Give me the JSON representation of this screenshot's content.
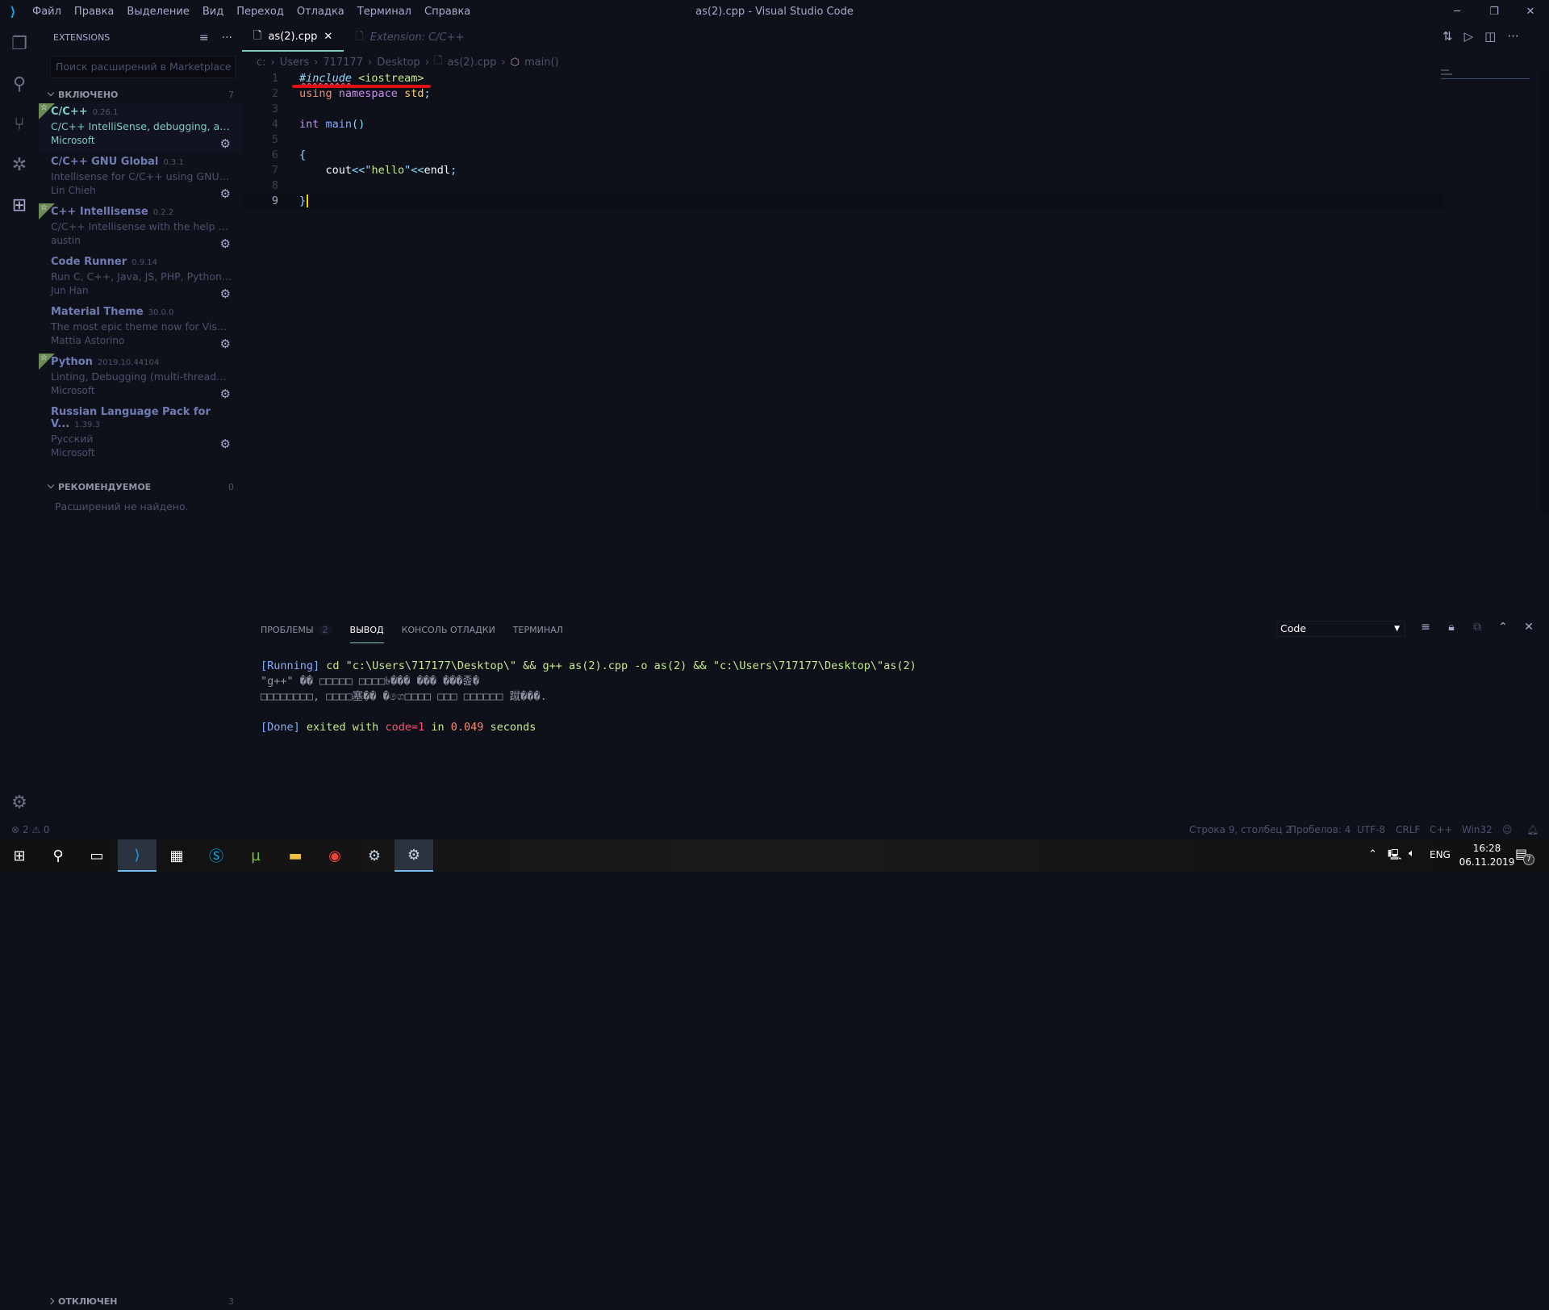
{
  "titlebar": {
    "logo": "vscode-logo",
    "menu": [
      "Файл",
      "Правка",
      "Выделение",
      "Вид",
      "Переход",
      "Отладка",
      "Терминал",
      "Справка"
    ],
    "title": "as(2).cpp - Visual Studio Code"
  },
  "sidebar": {
    "header": "EXTENSIONS",
    "search_placeholder": "Поиск расширений в Marketplace",
    "enabled_label": "ВКЛЮЧЕНО",
    "enabled_count": "7",
    "extensions": [
      {
        "name": "C/C++",
        "version": "0.26.1",
        "desc": "C/C++ IntelliSense, debugging, and c...",
        "publisher": "Microsoft",
        "starred": true,
        "selected": true
      },
      {
        "name": "C/C++ GNU Global",
        "version": "0.3.1",
        "desc": "Intellisense for C/C++ using GNU Glo...",
        "publisher": "Lin Chieh",
        "starred": false
      },
      {
        "name": "C++ Intellisense",
        "version": "0.2.2",
        "desc": "C/C++ Intellisense with the help of G...",
        "publisher": "austin",
        "starred": true
      },
      {
        "name": "Code Runner",
        "version": "0.9.14",
        "desc": "Run C, C++, Java, JS, PHP, Python, Per...",
        "publisher": "Jun Han",
        "starred": false
      },
      {
        "name": "Material Theme",
        "version": "30.0.0",
        "desc": "The most epic theme now for Visual S...",
        "publisher": "Mattia Astorino",
        "starred": false
      },
      {
        "name": "Python",
        "version": "2019.10.44104",
        "desc": "Linting, Debugging (multi-threaded, r...",
        "publisher": "Microsoft",
        "starred": true
      },
      {
        "name": "Russian Language Pack for V...",
        "version": "1.39.3",
        "desc": "Русский",
        "publisher": "Microsoft",
        "starred": false
      }
    ],
    "recommended_label": "РЕКОМЕНДУЕМОЕ",
    "recommended_count": "0",
    "no_results": "Расширений не найдено.",
    "disabled_label": "ОТКЛЮЧЕН",
    "disabled_count": "3"
  },
  "tabs": [
    {
      "label": "as(2).cpp",
      "active": true
    },
    {
      "label": "Extension: C/C++",
      "active": false
    }
  ],
  "breadcrumb": [
    "c:",
    "Users",
    "717177",
    "Desktop",
    "as(2).cpp",
    "main()"
  ],
  "editor": {
    "lines": [
      [
        {
          "t": "#include",
          "c": "#89ddff",
          "i": true
        },
        {
          "t": " ",
          "c": "#fff"
        },
        {
          "t": "<iostream>",
          "c": "#c3e88d"
        }
      ],
      [
        {
          "t": "using",
          "c": "#f78c6c"
        },
        {
          "t": " ",
          "c": "#fff"
        },
        {
          "t": "namespace",
          "c": "#c792ea"
        },
        {
          "t": " ",
          "c": "#fff"
        },
        {
          "t": "std",
          "c": "#ffcb6b"
        },
        {
          "t": ";",
          "c": "#89ddff"
        }
      ],
      [],
      [
        {
          "t": "int",
          "c": "#c792ea"
        },
        {
          "t": " ",
          "c": "#fff"
        },
        {
          "t": "main",
          "c": "#82aaff"
        },
        {
          "t": "()",
          "c": "#89ddff"
        }
      ],
      [],
      [
        {
          "t": "{",
          "c": "#89ddff"
        }
      ],
      [
        {
          "t": "    cout",
          "c": "#eeffff"
        },
        {
          "t": "<<",
          "c": "#89ddff"
        },
        {
          "t": "\"",
          "c": "#89ddff"
        },
        {
          "t": "hello",
          "c": "#c3e88d"
        },
        {
          "t": "\"",
          "c": "#89ddff"
        },
        {
          "t": "<<",
          "c": "#89ddff"
        },
        {
          "t": "endl",
          "c": "#eeffff"
        },
        {
          "t": ";",
          "c": "#89ddff"
        }
      ],
      [],
      [
        {
          "t": "}",
          "c": "#89ddff"
        }
      ]
    ],
    "current_line": 9
  },
  "panel": {
    "tabs": [
      {
        "label": "ПРОБЛЕМЫ",
        "badge": "2"
      },
      {
        "label": "ВЫВОД",
        "active": true
      },
      {
        "label": "КОНСОЛЬ ОТЛАДКИ"
      },
      {
        "label": "ТЕРМИНАЛ"
      }
    ],
    "channel": "Code",
    "output": {
      "running_tag": "[Running]",
      "command": " cd \"c:\\Users\\717177\\Desktop\\\" && g++ as(2).cpp -o as(2) && \"c:\\Users\\717177\\Desktop\\\"as(2)",
      "garbled1": "\"g++\" �� □□□□□ □□□□৳��� ��� ���졾�",
      "garbled2": "□□□□□□□□, □□□□塞�� �ගෙ□□□□ □□□ □□□□□□ 蹴���.",
      "done_tag": "[Done]",
      "exited": " exited with ",
      "code": "code=1",
      "in": " in ",
      "time": "0.049",
      "seconds": " seconds"
    }
  },
  "status": {
    "errors": "2",
    "warnings": "0",
    "position": "Строка 9, столбец 2",
    "spaces": "Пробелов: 4",
    "encoding": "UTF-8",
    "eol": "CRLF",
    "language": "C++",
    "platform": "Win32"
  },
  "taskbar": {
    "lang": "ENG",
    "time": "16:28",
    "date": "06.11.2019",
    "notifications": "7"
  },
  "colors": {
    "background": "#0f111a",
    "accent": "#80cbc4",
    "star": "#6b8a55"
  }
}
